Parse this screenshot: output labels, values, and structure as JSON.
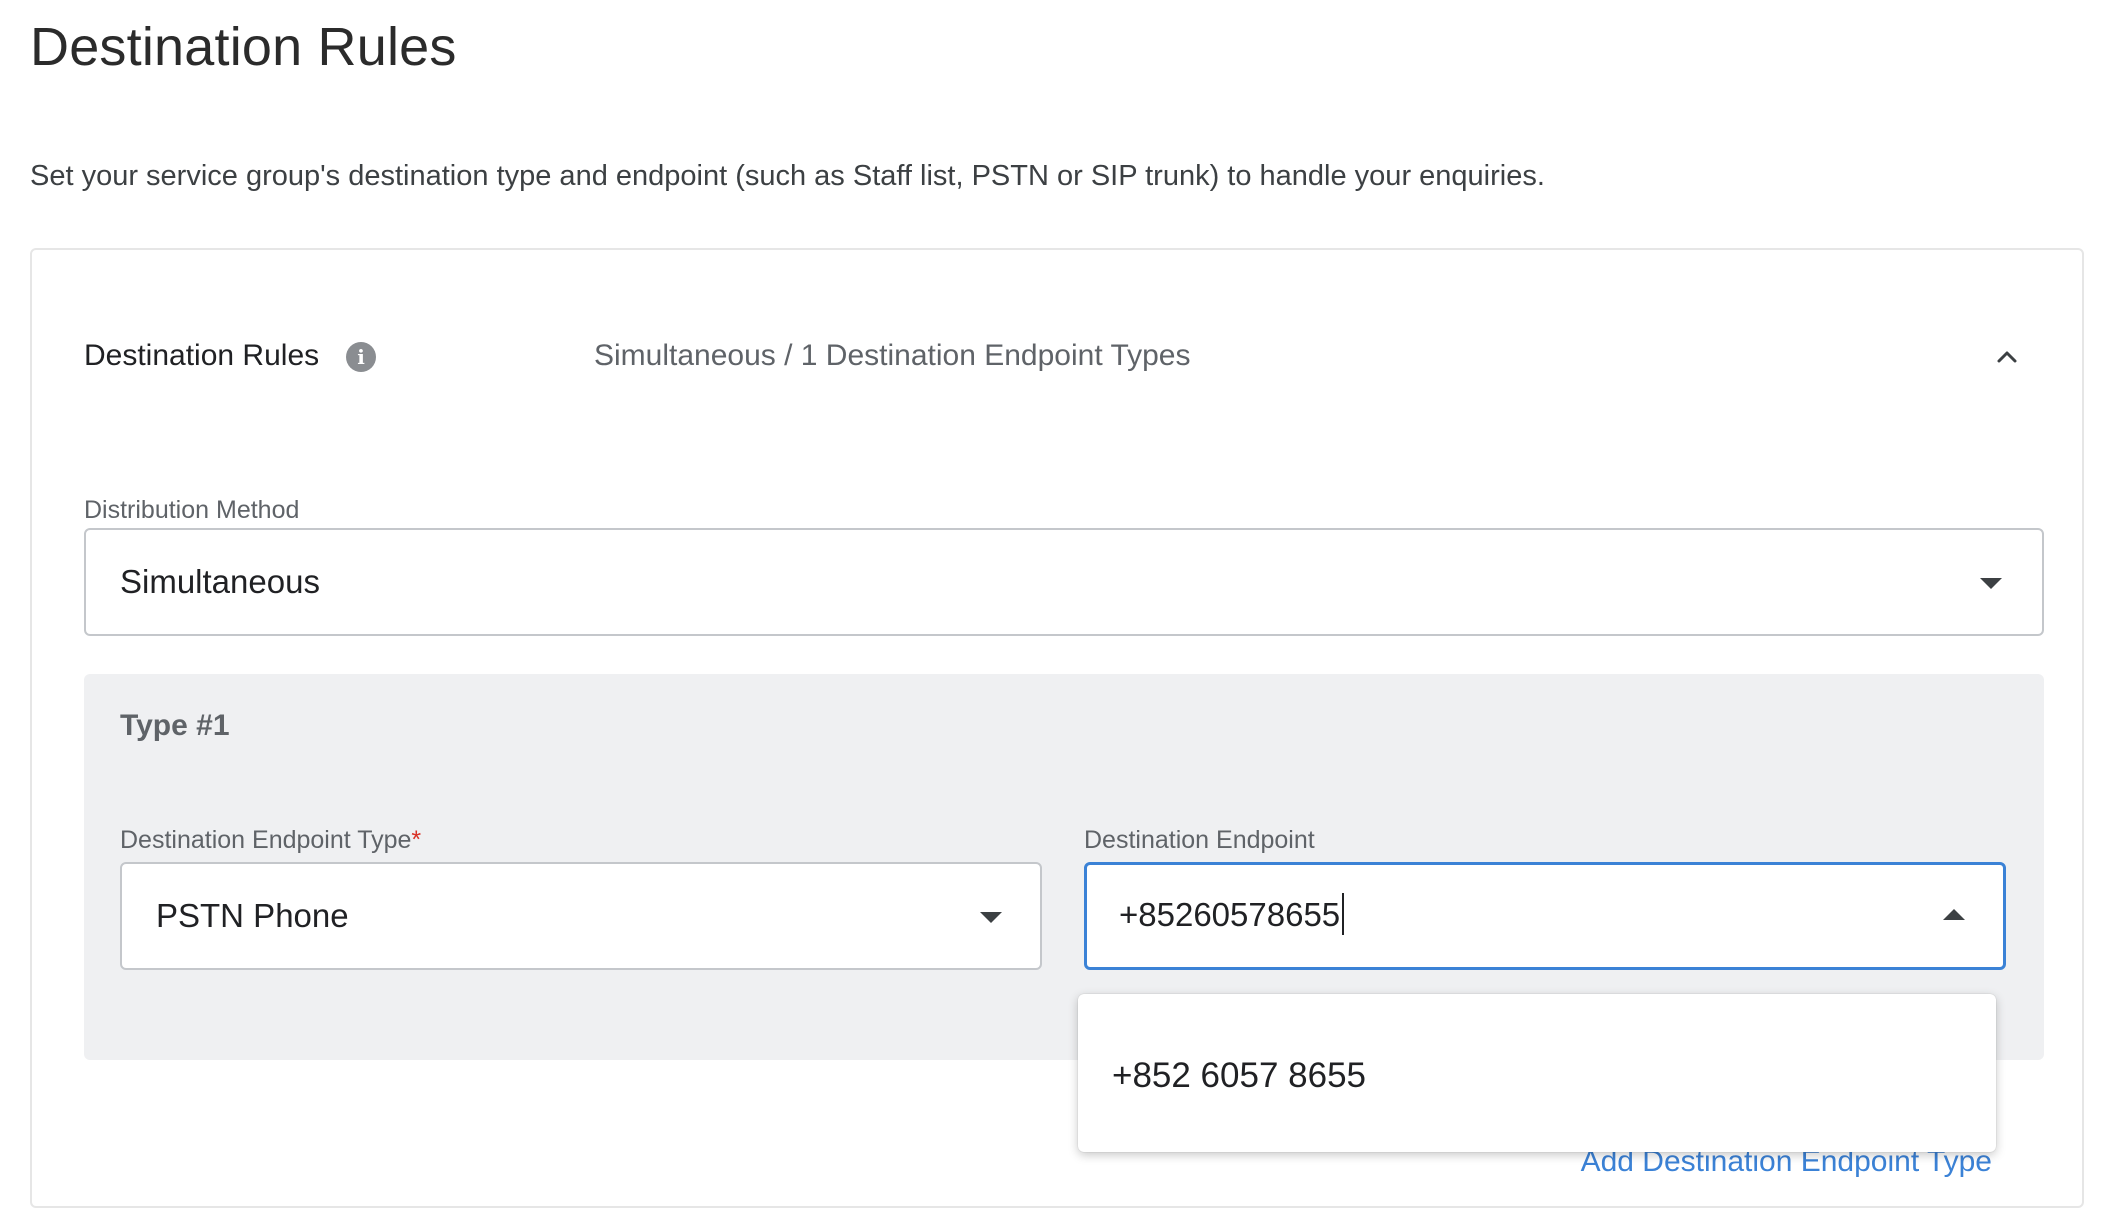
{
  "page": {
    "title": "Destination Rules",
    "description": "Set your service group's destination type and endpoint (such as Staff list, PSTN or SIP trunk) to handle your enquiries."
  },
  "rules_panel": {
    "title": "Destination Rules",
    "info_icon": "info-icon",
    "summary": "Simultaneous / 1 Destination Endpoint Types",
    "collapse_icon": "chevron-up-icon",
    "expanded": true
  },
  "distribution": {
    "label": "Distribution Method",
    "value": "Simultaneous"
  },
  "type_block": {
    "title": "Type #1",
    "endpoint_type": {
      "label": "Destination Endpoint Type",
      "required_mark": "*",
      "value": "PSTN Phone"
    },
    "endpoint": {
      "label": "Destination Endpoint",
      "value": "+85260578655",
      "dropdown_open": true,
      "options": [
        "+852 6057 8655"
      ]
    }
  },
  "footer": {
    "add_link": "Add Destination Endpoint Type"
  },
  "colors": {
    "accent": "#3b82d6",
    "required": "#d93025",
    "panel_bg": "#eff0f2"
  }
}
